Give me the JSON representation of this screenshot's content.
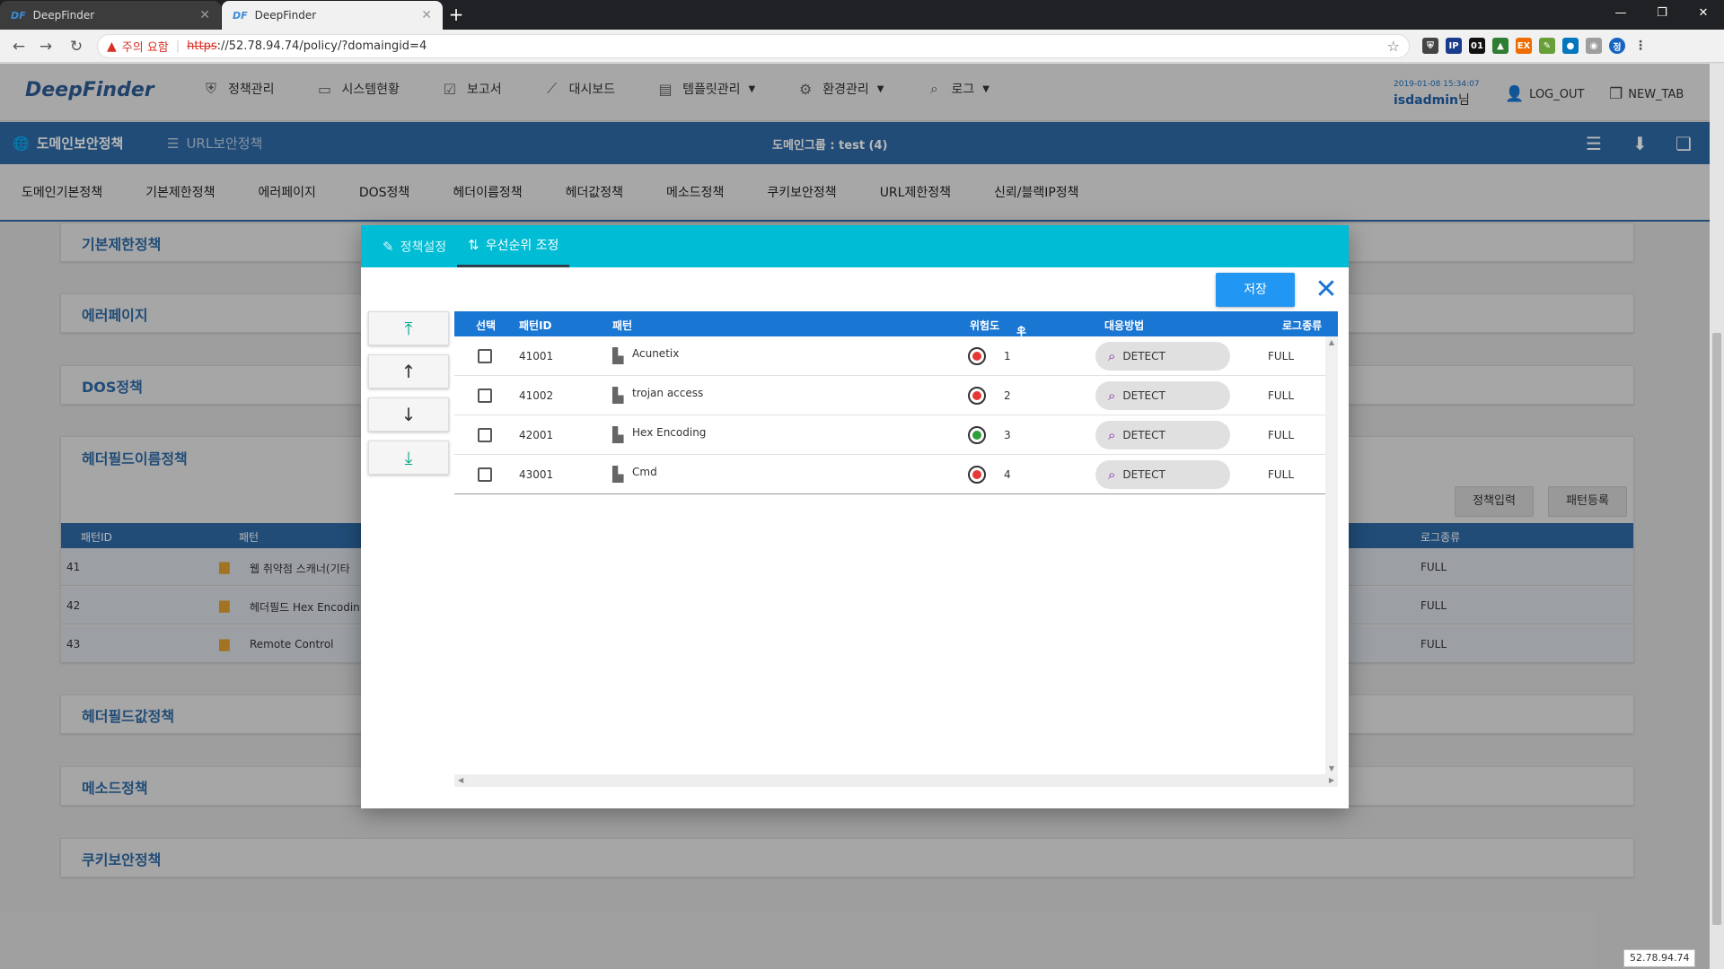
{
  "browser": {
    "tabs": [
      {
        "logo": "DF",
        "title": "DeepFinder"
      },
      {
        "logo": "DF",
        "title": "DeepFinder"
      }
    ],
    "newtab": "+",
    "security_warning": "주의 요함",
    "url_scheme": "https",
    "url_rest": "://52.78.94.74/policy/?domaingid=4",
    "ext_ip": "IP",
    "ext_01": "01",
    "ext_ex": "EX",
    "profile": "정"
  },
  "header": {
    "logo": "DeepFinder",
    "nav": [
      {
        "label": "정책관리",
        "icon": "shield-icon",
        "dropdown": false
      },
      {
        "label": "시스템현황",
        "icon": "monitor-icon",
        "dropdown": false
      },
      {
        "label": "보고서",
        "icon": "clipboard-icon",
        "dropdown": false
      },
      {
        "label": "대시보드",
        "icon": "trend-icon",
        "dropdown": false
      },
      {
        "label": "템플릿관리",
        "icon": "template-icon",
        "dropdown": true
      },
      {
        "label": "환경관리",
        "icon": "gear-icon",
        "dropdown": true
      },
      {
        "label": "로그",
        "icon": "search-icon",
        "dropdown": true
      }
    ],
    "datetime": "2019-01-08 15:34:07",
    "username": "isdadmin",
    "username_suffix": "님",
    "logout": "LOG_OUT",
    "newtab": "NEW_TAB"
  },
  "subbar": {
    "domain_policy": "도메인보안정책",
    "url_policy": "URL보안정책",
    "group_label": "도메인그룹 : test (4)"
  },
  "category_tabs": [
    "도메인기본정책",
    "기본제한정책",
    "에러페이지",
    "DOS정책",
    "헤더이름정책",
    "헤더값정책",
    "메소드정책",
    "쿠키보안정책",
    "URL제한정책",
    "신뢰/블랙IP정책"
  ],
  "background": {
    "panels": [
      "기본제한정책",
      "에러페이지",
      "DOS정책",
      "헤더필드이름정책",
      "헤더필드값정책",
      "메소드정책",
      "쿠키보안정책"
    ],
    "policy_input_btn": "정책입력",
    "pattern_register_btn": "패턴등록",
    "table": {
      "headers": {
        "id": "패턴ID",
        "pattern": "패턴",
        "logtype": "로그종류"
      },
      "rows": [
        {
          "id": "41",
          "pattern": "웹 취약점 스캐너(기타",
          "logtype": "FULL"
        },
        {
          "id": "42",
          "pattern": "헤더필드 Hex Encodin",
          "logtype": "FULL"
        },
        {
          "id": "43",
          "pattern": "Remote Control",
          "logtype": "FULL"
        }
      ]
    },
    "ip_badge": "52.78.94.74"
  },
  "modal": {
    "tabs": [
      {
        "label": "정책설정",
        "icon": "pencil-icon"
      },
      {
        "label": "우선순위 조정",
        "icon": "sort-icon"
      }
    ],
    "active_tab": 1,
    "save_label": "저장",
    "columns": {
      "select": "선택",
      "pattern_id": "패턴ID",
      "pattern": "패턴",
      "risk": "위험도",
      "priority": "우선순위",
      "action": "대응방법",
      "logtype": "로그종류"
    },
    "sort_indicator": "↑",
    "rows": [
      {
        "id": "41001",
        "pattern": "Acunetix",
        "risk_color": "#e53935",
        "priority": "1",
        "action": "DETECT",
        "logtype": "FULL"
      },
      {
        "id": "41002",
        "pattern": "trojan access",
        "risk_color": "#e53935",
        "priority": "2",
        "action": "DETECT",
        "logtype": "FULL"
      },
      {
        "id": "42001",
        "pattern": "Hex Encoding",
        "risk_color": "#2e9e3a",
        "priority": "3",
        "action": "DETECT",
        "logtype": "FULL"
      },
      {
        "id": "43001",
        "pattern": "Cmd",
        "risk_color": "#e53935",
        "priority": "4",
        "action": "DETECT",
        "logtype": "FULL"
      }
    ]
  }
}
